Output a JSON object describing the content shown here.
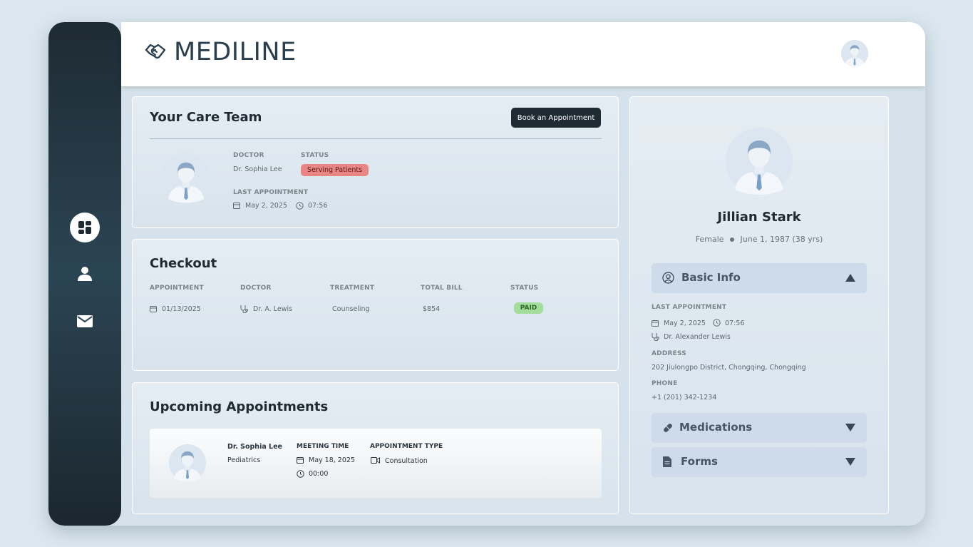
{
  "app": {
    "name": "MEDILINE"
  },
  "sidebar": {
    "items": [
      {
        "icon": "dashboard-icon"
      },
      {
        "icon": "user-icon"
      },
      {
        "icon": "mail-icon"
      }
    ]
  },
  "care_team": {
    "title": "Your Care Team",
    "book_label": "Book an Appointment",
    "doctor_label": "DOCTOR",
    "doctor_name": "Dr. Sophia Lee",
    "status_label": "STATUS",
    "status_value": "Serving Patients",
    "last_appt_label": "LAST APPOINTMENT",
    "last_appt_date": "May 2, 2025",
    "last_appt_time": "07:56",
    "colors": {
      "status_badge": "#e98585"
    }
  },
  "checkout": {
    "title": "Checkout",
    "columns": [
      "APPOINTMENT",
      "DOCTOR",
      "TREATMENT",
      "TOTAL BILL",
      "STATUS"
    ],
    "row": {
      "appointment": "01/13/2025",
      "doctor": "Dr. A. Lewis",
      "treatment": "Counseling",
      "total_bill": "$854",
      "status": "PAID"
    },
    "colors": {
      "paid_badge": "#a4dc9c"
    }
  },
  "upcoming": {
    "title": "Upcoming Appointments",
    "doctor_name": "Dr. Sophia Lee",
    "specialty": "Pediatrics",
    "meeting_time_label": "MEETING TIME",
    "date": "May 18, 2025",
    "time": "00:00",
    "type_label": "APPOINTMENT TYPE",
    "type": "Consultation"
  },
  "profile": {
    "name": "Jillian Stark",
    "gender": "Female",
    "dob": "June 1, 1987 (38 yrs)",
    "basic_info_label": "Basic Info",
    "last_appt_label": "LAST APPOINTMENT",
    "last_appt_date": "May 2, 2025",
    "last_appt_time": "07:56",
    "last_appt_doctor": "Dr. Alexander Lewis",
    "address_label": "ADDRESS",
    "address": "202 Jiulongpo District, Chongqing, Chongqing",
    "phone_label": "PHONE",
    "phone": "+1 (201) 342-1234",
    "medications_label": "Medications",
    "forms_label": "Forms"
  }
}
